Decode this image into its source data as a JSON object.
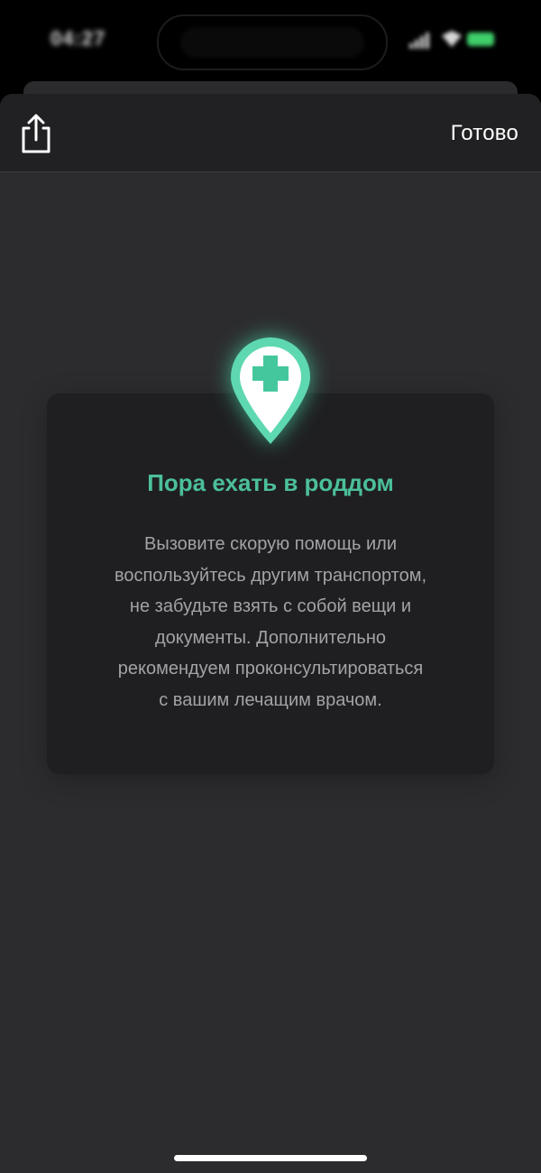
{
  "status_bar": {
    "time": "04:27"
  },
  "nav": {
    "share_icon": "share-icon",
    "done_label": "Готово"
  },
  "card": {
    "icon": "location-pin-medical-cross-icon",
    "title": "Пора ехать в роддом",
    "body": "Вызовите скорую помощь или\nвоспользуйтесь другим транспортом,\nне забудьте взять с собой вещи и\nдокументы. Дополнительно\nрекомендуем проконсультироваться\nс вашим лечащим врачом."
  },
  "colors": {
    "accent": "#4bbf9b",
    "pin": "#5ed8b1",
    "background": "#2c2c2e",
    "card": "#1f1f21",
    "nav": "#212123"
  }
}
